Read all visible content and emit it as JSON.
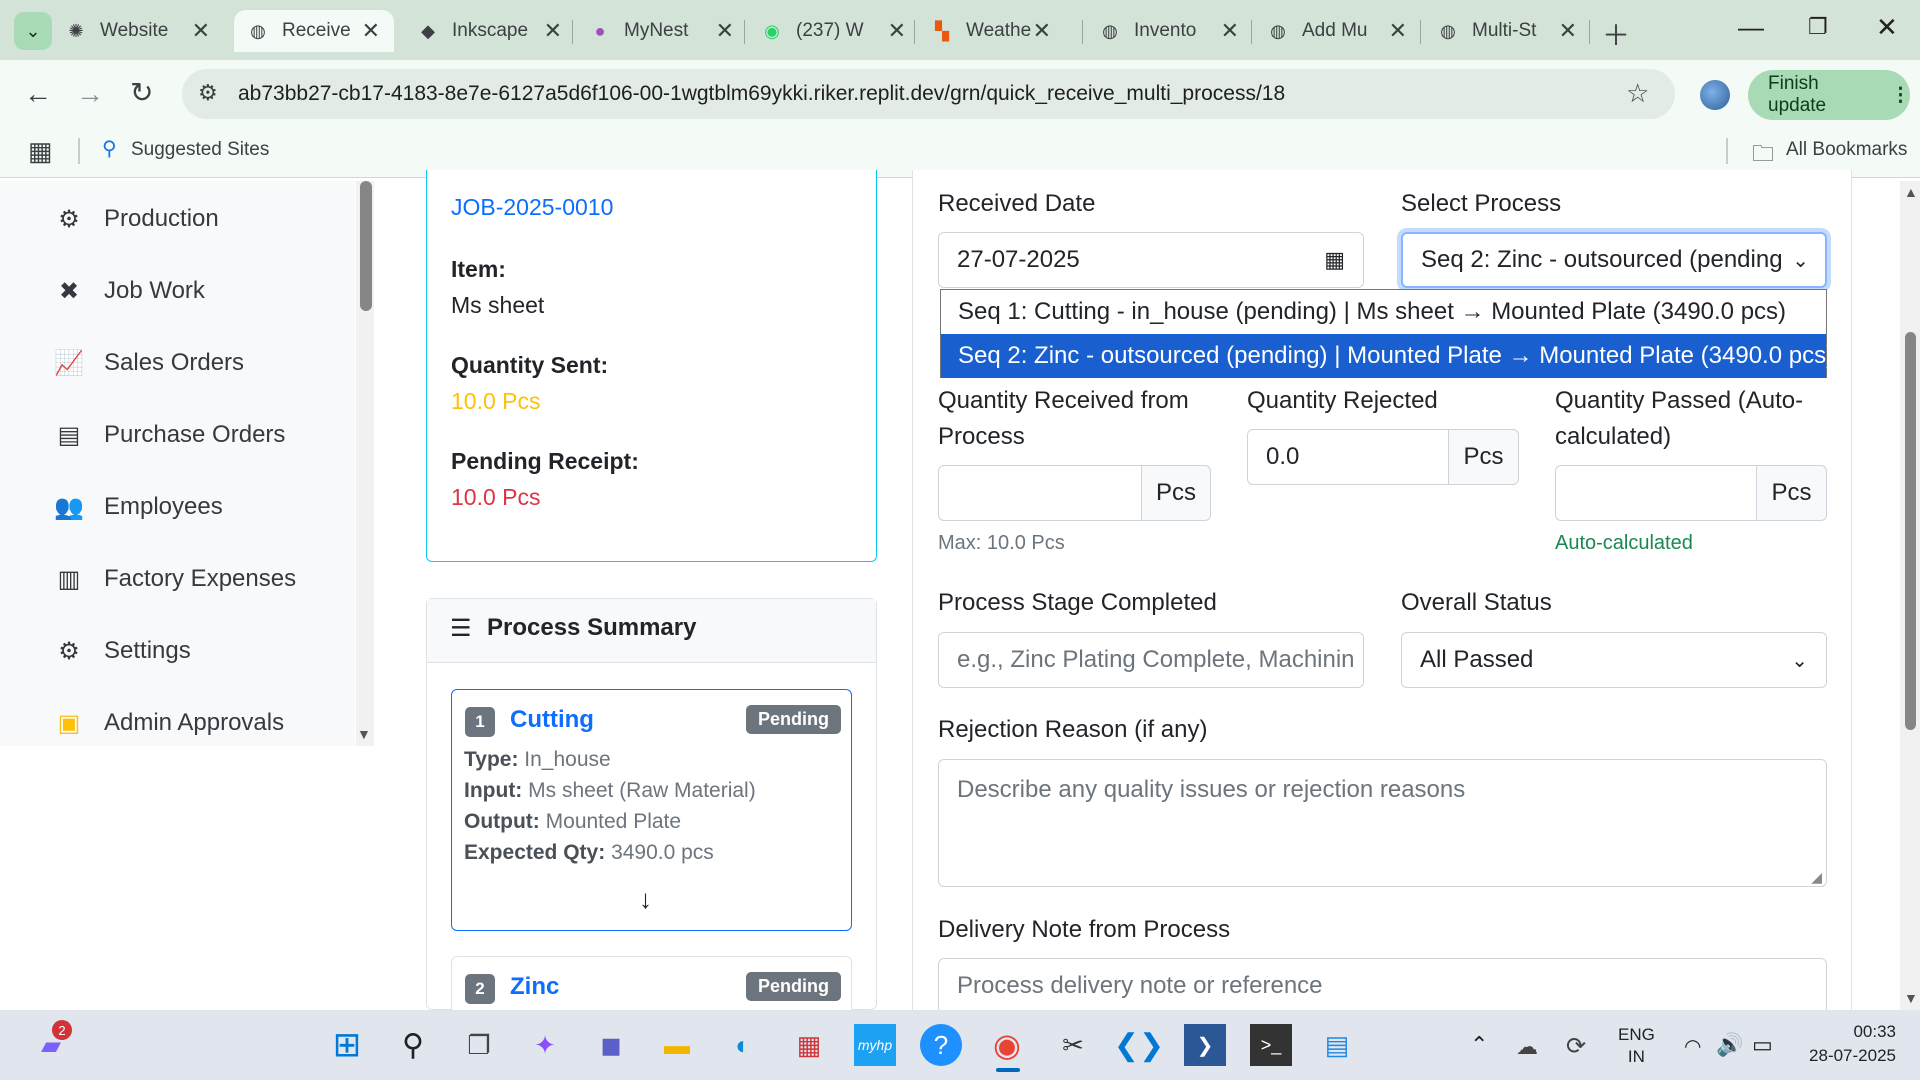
{
  "browser": {
    "tabs": [
      {
        "label": "Website",
        "icon": "openai-icon"
      },
      {
        "label": "Receive",
        "icon": "globe-icon"
      },
      {
        "label": "Inkscape",
        "icon": "inkscape-icon"
      },
      {
        "label": "MyNest",
        "icon": "mynest-icon"
      },
      {
        "label": "(237) W",
        "icon": "whatsapp-icon"
      },
      {
        "label": "Weathe",
        "icon": "weather-icon"
      },
      {
        "label": "Invento",
        "icon": "globe-icon"
      },
      {
        "label": "Add Mu",
        "icon": "globe-icon"
      },
      {
        "label": "Multi-St",
        "icon": "globe-icon"
      }
    ],
    "url": "ab73bb27-cb17-4183-8e7e-6127a5d6f106-00-1wgtblm69ykki.riker.replit.dev/grn/quick_receive_multi_process/18",
    "finish_update": "Finish update",
    "suggested_sites": "Suggested Sites",
    "all_bookmarks": "All Bookmarks"
  },
  "sidebar": {
    "items": [
      {
        "label": "Production",
        "icon": "cogs-icon"
      },
      {
        "label": "Job Work",
        "icon": "tools-icon"
      },
      {
        "label": "Sales Orders",
        "icon": "chart-line-icon"
      },
      {
        "label": "Purchase Orders",
        "icon": "file-invoice-icon"
      },
      {
        "label": "Employees",
        "icon": "users-icon"
      },
      {
        "label": "Factory Expenses",
        "icon": "receipt-icon"
      },
      {
        "label": "Settings",
        "icon": "gear-icon"
      },
      {
        "label": "Admin Approvals",
        "icon": "clipboard-check-icon"
      }
    ]
  },
  "job_card": {
    "job_number": "JOB-2025-0010",
    "item_label": "Item:",
    "item_value": "Ms sheet",
    "qty_sent_label": "Quantity Sent:",
    "qty_sent_value": "10.0 Pcs",
    "pending_label": "Pending Receipt:",
    "pending_value": "10.0 Pcs"
  },
  "process_summary": {
    "title": "Process Summary",
    "steps": [
      {
        "num": "1",
        "name": "Cutting",
        "status": "Pending",
        "type_label": "Type:",
        "type": "In_house",
        "input_label": "Input:",
        "input": "Ms sheet (Raw Material)",
        "output_label": "Output:",
        "output": "Mounted Plate",
        "qty_label": "Expected Qty:",
        "qty": "3490.0 pcs"
      },
      {
        "num": "2",
        "name": "Zinc",
        "status": "Pending"
      }
    ]
  },
  "form": {
    "received_date_label": "Received Date",
    "received_date": "27-07-2025",
    "select_process_label": "Select Process",
    "select_process_value": "Seq 2: Zinc - outsourced (pending",
    "process_options": [
      "Seq 1: Cutting - in_house (pending) | Ms sheet → Mounted Plate (3490.0 pcs)",
      "Seq 2: Zinc - outsourced (pending) | Mounted Plate → Mounted Plate (3490.0 pcs)"
    ],
    "qty_received_label_1": "Quantity Received from",
    "qty_received_label_2": "Process",
    "qty_received_value": "",
    "qty_received_unit": "Pcs",
    "qty_received_help": "Max: 10.0 Pcs",
    "qty_rejected_label": "Quantity Rejected",
    "qty_rejected_value": "0.0",
    "qty_rejected_unit": "Pcs",
    "qty_passed_label_1": "Quantity Passed (Auto-",
    "qty_passed_label_2": "calculated)",
    "qty_passed_unit": "Pcs",
    "qty_passed_help": "Auto-calculated",
    "stage_label": "Process Stage Completed",
    "stage_placeholder": "e.g., Zinc Plating Complete, Machinin",
    "overall_status_label": "Overall Status",
    "overall_status_value": "All Passed",
    "rejection_label": "Rejection Reason (if any)",
    "rejection_placeholder": "Describe any quality issues or rejection reasons",
    "delivery_label": "Delivery Note from Process",
    "delivery_placeholder": "Process delivery note or reference"
  },
  "taskbar": {
    "notification_count": "2",
    "lang_1": "ENG",
    "lang_2": "IN",
    "time": "00:33",
    "date": "28-07-2025"
  },
  "colors": {
    "primary": "#0d6efd",
    "warning": "#ffc107",
    "danger": "#dc3545",
    "success": "#198754",
    "chrome_green": "#d3e3d7"
  }
}
